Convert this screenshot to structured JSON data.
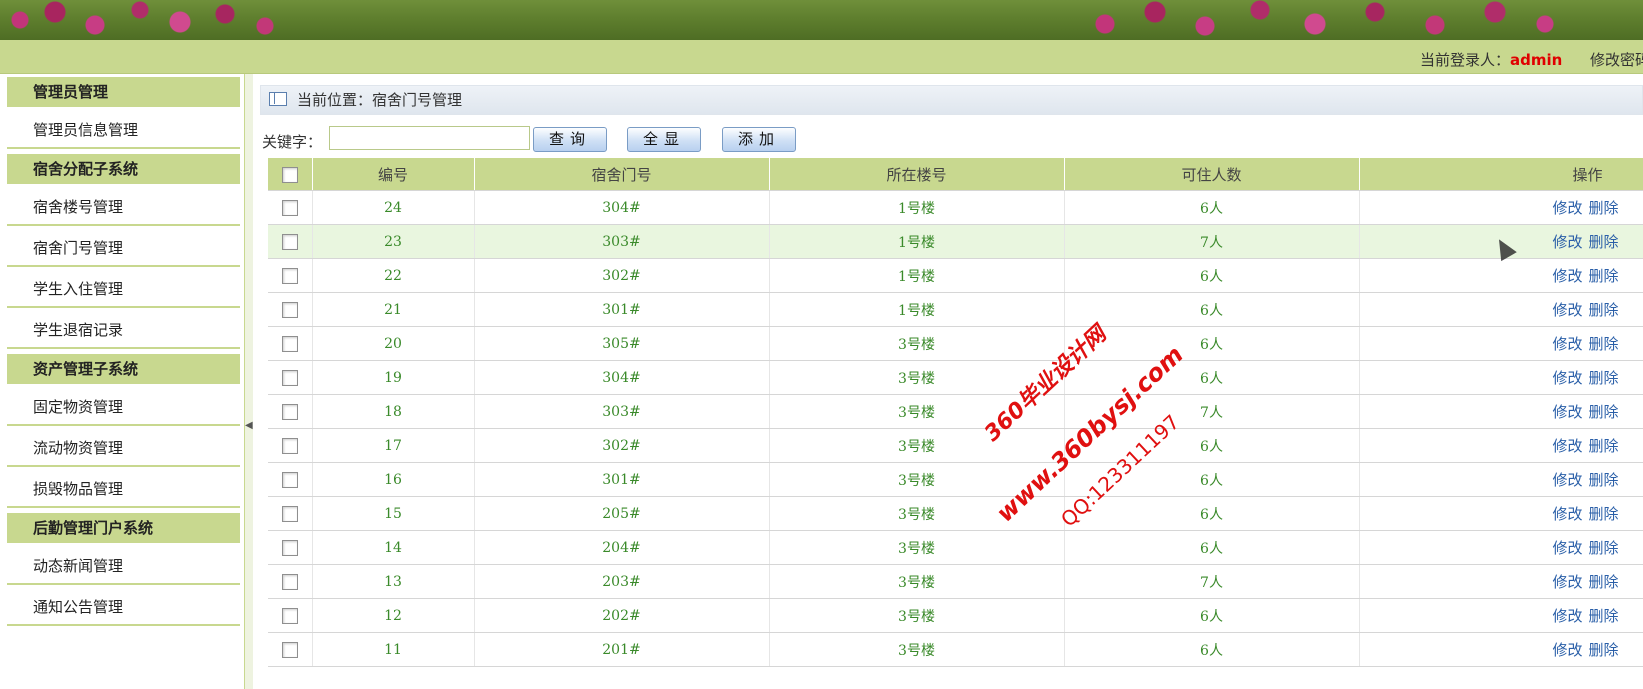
{
  "header": {
    "login_label": "当前登录人：",
    "login_user": "admin",
    "change_password": "修改密码"
  },
  "sidebar": {
    "sections": [
      {
        "title": "管理员管理",
        "items": [
          "管理员信息管理"
        ]
      },
      {
        "title": "宿舍分配子系统",
        "items": [
          "宿舍楼号管理",
          "宿舍门号管理",
          "学生入住管理",
          "学生退宿记录"
        ]
      },
      {
        "title": "资产管理子系统",
        "items": [
          "固定物资管理",
          "流动物资管理",
          "损毁物品管理"
        ]
      },
      {
        "title": "后勤管理门户系统",
        "items": [
          "动态新闻管理",
          "通知公告管理"
        ]
      }
    ]
  },
  "main": {
    "location": "当前位置：宿舍门号管理",
    "search_label": "关键字：",
    "search_value": "",
    "buttons": {
      "query": "查询",
      "all": "全显",
      "add": "添加"
    },
    "columns": [
      "编号",
      "宿舍门号",
      "所在楼号",
      "可住人数",
      "操作"
    ],
    "rows": [
      {
        "id": "24",
        "door": "304#",
        "building": "1号楼",
        "capacity": "6人"
      },
      {
        "id": "23",
        "door": "303#",
        "building": "1号楼",
        "capacity": "7人"
      },
      {
        "id": "22",
        "door": "302#",
        "building": "1号楼",
        "capacity": "6人"
      },
      {
        "id": "21",
        "door": "301#",
        "building": "1号楼",
        "capacity": "6人"
      },
      {
        "id": "20",
        "door": "305#",
        "building": "3号楼",
        "capacity": "6人"
      },
      {
        "id": "19",
        "door": "304#",
        "building": "3号楼",
        "capacity": "6人"
      },
      {
        "id": "18",
        "door": "303#",
        "building": "3号楼",
        "capacity": "7人"
      },
      {
        "id": "17",
        "door": "302#",
        "building": "3号楼",
        "capacity": "6人"
      },
      {
        "id": "16",
        "door": "301#",
        "building": "3号楼",
        "capacity": "6人"
      },
      {
        "id": "15",
        "door": "205#",
        "building": "3号楼",
        "capacity": "6人"
      },
      {
        "id": "14",
        "door": "204#",
        "building": "3号楼",
        "capacity": "6人"
      },
      {
        "id": "13",
        "door": "203#",
        "building": "3号楼",
        "capacity": "7人"
      },
      {
        "id": "12",
        "door": "202#",
        "building": "3号楼",
        "capacity": "6人"
      },
      {
        "id": "11",
        "door": "201#",
        "building": "3号楼",
        "capacity": "6人"
      }
    ],
    "row_actions": {
      "edit": "修改",
      "delete": "删除"
    },
    "highlight_row": 1
  },
  "watermark": {
    "line1": "360毕业设计网",
    "line2": "www.360bysj.com",
    "line3": "QQ:123311197"
  }
}
